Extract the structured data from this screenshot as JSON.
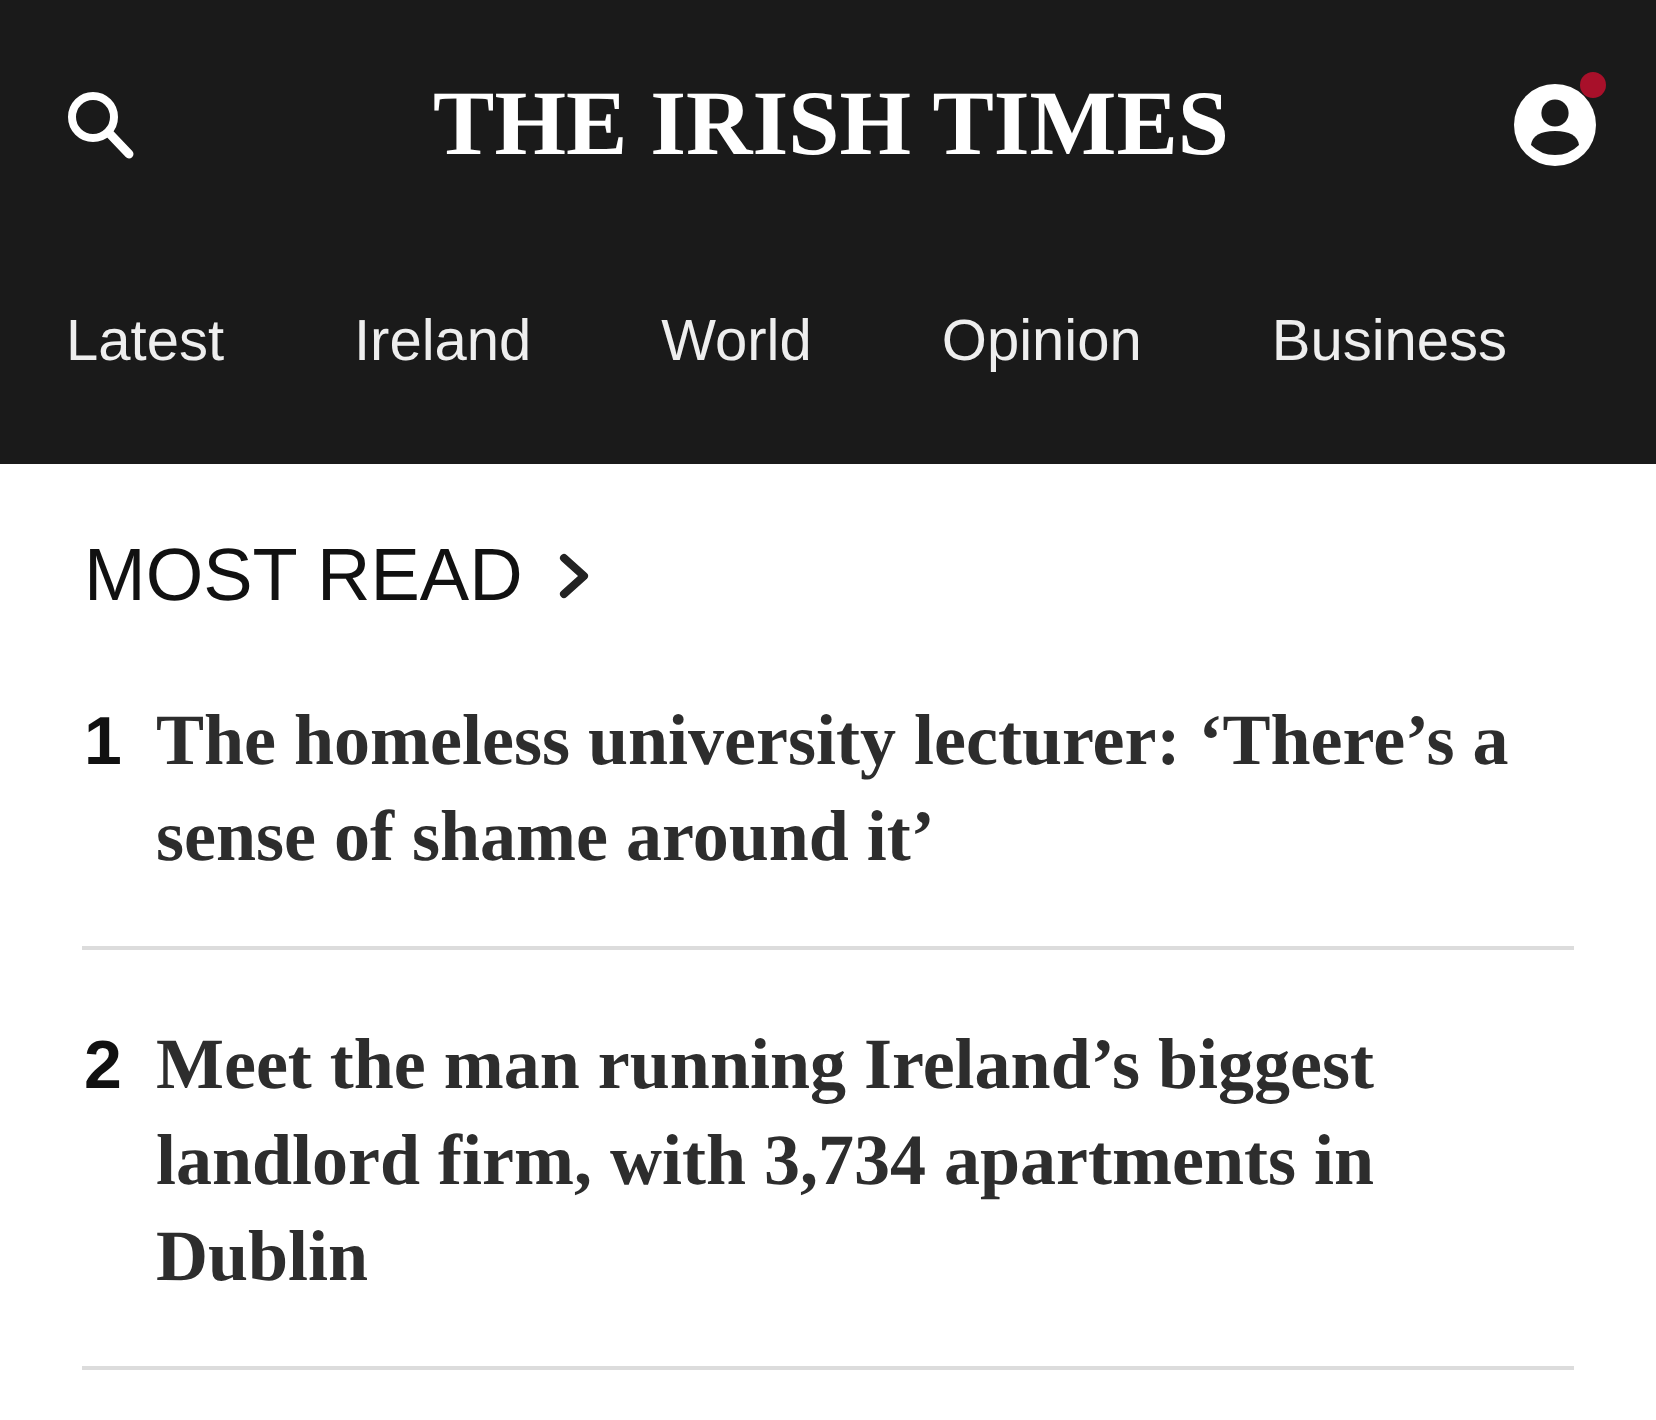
{
  "header": {
    "logo": "THE IRISH TIMES",
    "account": {
      "notification": true
    }
  },
  "nav": {
    "items": [
      "Latest",
      "Ireland",
      "World",
      "Opinion",
      "Business"
    ]
  },
  "most_read": {
    "title": "MOST READ",
    "articles": [
      {
        "rank": "1",
        "headline": "The homeless university lecturer: ‘There’s a sense of shame around it’"
      },
      {
        "rank": "2",
        "headline": "Meet the man running Ireland’s biggest landlord firm, with 3,734 apartments in Dublin"
      }
    ]
  }
}
